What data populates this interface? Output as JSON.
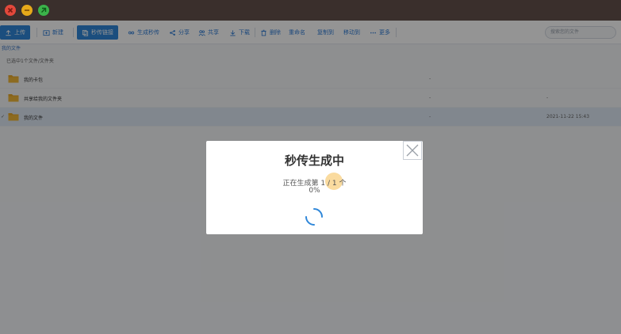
{
  "toolbar": {
    "upload": "上传",
    "new": "新建",
    "rapid_link": "秒传链接",
    "generate_rapid": "生成秒传",
    "share": "分享",
    "share_with": "共享",
    "download": "下载",
    "delete": "删除",
    "rename": "重命名",
    "copy_to": "复制到",
    "move_to": "移动到",
    "more": "更多",
    "search_placeholder": "搜索您的文件"
  },
  "breadcrumb": "我的文件",
  "selection_info": "已选中1个文件/文件夹",
  "files": [
    {
      "name": "我的卡包",
      "size": "-",
      "date": ""
    },
    {
      "name": "共享给我的文件夹",
      "size": "-",
      "date": "-"
    },
    {
      "name": "我的文件",
      "size": "-",
      "date": "2021-11-22 15:43"
    }
  ],
  "modal": {
    "title": "秒传生成中",
    "progress_text": "正在生成第 1 / 1 个",
    "percent": "0%"
  },
  "colors": {
    "accent": "#2f87d9",
    "folder": "#e8a92a",
    "title_bar": "#3a2f2c"
  }
}
